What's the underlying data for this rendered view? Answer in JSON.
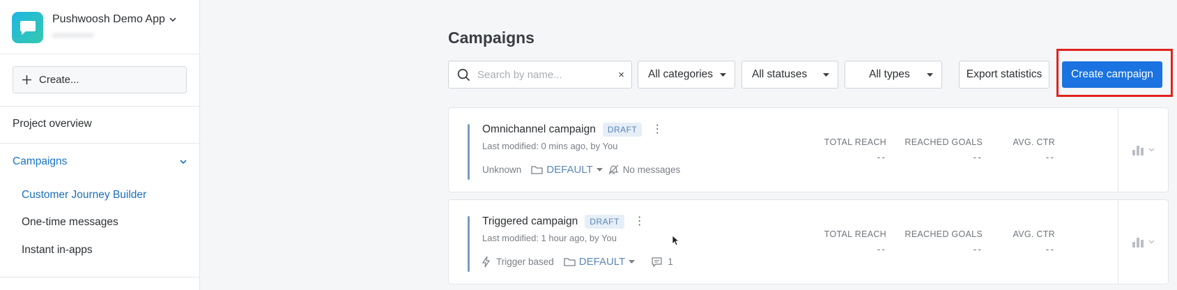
{
  "app": {
    "name": "Pushwoosh Demo App",
    "subtitle": "•••••••••••••"
  },
  "sidebar": {
    "create_label": "Create...",
    "project_overview": "Project overview",
    "campaigns_label": "Campaigns",
    "sub_items": [
      {
        "label": "Customer Journey Builder",
        "active": true
      },
      {
        "label": "One-time messages",
        "active": false
      },
      {
        "label": "Instant in-apps",
        "active": false
      }
    ]
  },
  "main": {
    "title": "Campaigns",
    "search": {
      "placeholder": "Search by name...",
      "clear": "×"
    },
    "filters": {
      "categories": "All categories",
      "statuses": "All statuses",
      "types": "All types"
    },
    "export_label": "Export statistics",
    "create_campaign_label": "Create campaign",
    "stat_labels": {
      "total_reach": "TOTAL REACH",
      "reached_goals": "REACHED GOALS",
      "avg_ctr": "AVG. CTR"
    },
    "campaigns": [
      {
        "name": "Omnichannel campaign",
        "status": "DRAFT",
        "modified": "Last modified: 0 mins ago, by You",
        "trigger": "Unknown",
        "folder": "DEFAULT",
        "messages": "No messages",
        "total_reach": "--",
        "reached_goals": "--",
        "avg_ctr": "--"
      },
      {
        "name": "Triggered campaign",
        "status": "DRAFT",
        "modified": "Last modified: 1 hour ago, by You",
        "trigger": "Trigger based",
        "folder": "DEFAULT",
        "messages": "1",
        "total_reach": "--",
        "reached_goals": "--",
        "avg_ctr": "--"
      }
    ]
  },
  "colors": {
    "accent": "#1a73e0",
    "highlight": "#e0231c",
    "active_link": "#1a6fbf"
  }
}
